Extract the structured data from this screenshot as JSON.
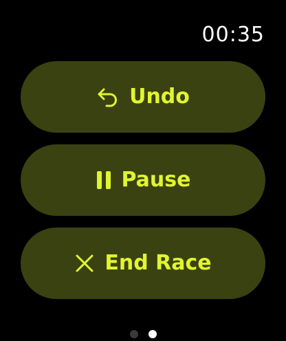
{
  "status": {
    "time": "00:35"
  },
  "actions": [
    {
      "id": "undo",
      "label": "Undo",
      "icon": "undo-arrow-icon"
    },
    {
      "id": "pause",
      "label": "Pause",
      "icon": "pause-icon"
    },
    {
      "id": "end",
      "label": "End Race",
      "icon": "close-x-icon"
    }
  ],
  "pager": {
    "page_count": 2,
    "current_page": 2
  },
  "colors": {
    "background": "#000000",
    "button_fill": "#3b4211",
    "accent": "#e1f531",
    "time_text": "#ffffff",
    "dot_inactive": "#3a3a3a",
    "dot_active": "#ffffff"
  }
}
